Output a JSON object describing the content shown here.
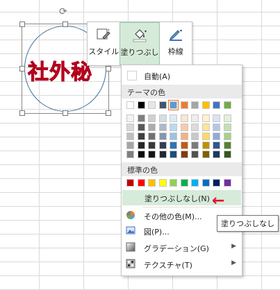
{
  "shape": {
    "text": "社外秘"
  },
  "toolbar": {
    "buttons": [
      {
        "label": "スタイル",
        "icon": "shape-style-icon"
      },
      {
        "label": "塗りつぶし",
        "icon": "paint-bucket-icon"
      },
      {
        "label": "枠線",
        "icon": "pen-outline-icon"
      }
    ]
  },
  "menu": {
    "auto_label": "自動(A)",
    "theme_header": "テーマの色",
    "standard_header": "標準の色",
    "no_fill_label": "塗りつぶしなし(N)",
    "more_colors_label": "その他の色(M)...",
    "picture_label": "図(P)...",
    "gradient_label": "グラデーション(G)",
    "texture_label": "テクスチャ(T)",
    "theme_colors": [
      [
        "#ffffff",
        "#000000",
        "#e7e6e6",
        "#44546a",
        "#5b9bd5",
        "#ed7d31",
        "#a5a5a5",
        "#ffc000",
        "#4472c4",
        "#70ad47"
      ],
      [
        "#f2f2f2",
        "#7f7f7f",
        "#d0cece",
        "#d6dce4",
        "#deebf6",
        "#fbe5d5",
        "#ededed",
        "#fff2cc",
        "#dae3f3",
        "#e2efd9"
      ],
      [
        "#d8d8d8",
        "#595959",
        "#aeabab",
        "#adb9ca",
        "#bdd7ee",
        "#f7cbac",
        "#dbdbdb",
        "#ffe599",
        "#b4c6e7",
        "#c5e0b3"
      ],
      [
        "#bfbfbf",
        "#3f3f3f",
        "#757070",
        "#8496b0",
        "#9cc3e5",
        "#f4b183",
        "#c9c9c9",
        "#ffd965",
        "#8eaadb",
        "#a8d08d"
      ],
      [
        "#a5a5a5",
        "#262626",
        "#3a3838",
        "#323f4f",
        "#2e75b5",
        "#c55a11",
        "#7b7b7b",
        "#bf9000",
        "#2f5496",
        "#538135"
      ],
      [
        "#7f7f7f",
        "#0c0c0c",
        "#171616",
        "#222a35",
        "#1e4e79",
        "#843c0b",
        "#525252",
        "#7f6000",
        "#203864",
        "#375623"
      ]
    ],
    "standard_colors": [
      "#c00000",
      "#ff0000",
      "#ffc000",
      "#ffff00",
      "#92d050",
      "#00b050",
      "#00b0f0",
      "#0070c0",
      "#002060",
      "#7030a0"
    ]
  },
  "tooltip": "塗りつぶしなし",
  "arrow": "←"
}
